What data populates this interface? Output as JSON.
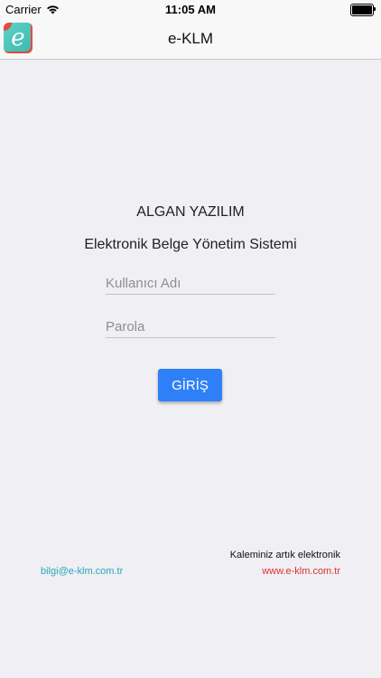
{
  "status_bar": {
    "carrier": "Carrier",
    "time": "11:05 AM",
    "wifi_icon": "wifi-icon",
    "battery_icon": "battery-icon"
  },
  "nav": {
    "title": "e-KLM",
    "logo_letter": "e",
    "logo_colors": {
      "primary": "#3bb8b0",
      "accent": "#e64b3c"
    }
  },
  "main": {
    "company": "ALGAN YAZILIM",
    "subtitle": "Elektronik Belge Yönetim Sistemi",
    "username": {
      "value": "",
      "placeholder": "Kullanıcı Adı"
    },
    "password": {
      "value": "",
      "placeholder": "Parola"
    },
    "login_label": "GİRİŞ"
  },
  "footer": {
    "tagline": "Kaleminiz artık elektronik",
    "email": "bilgi@e-klm.com.tr",
    "website": "www.e-klm.com.tr"
  },
  "colors": {
    "background": "#efeff4",
    "button": "#2f80f7",
    "email": "#2aa8b8",
    "website": "#e0312c"
  }
}
